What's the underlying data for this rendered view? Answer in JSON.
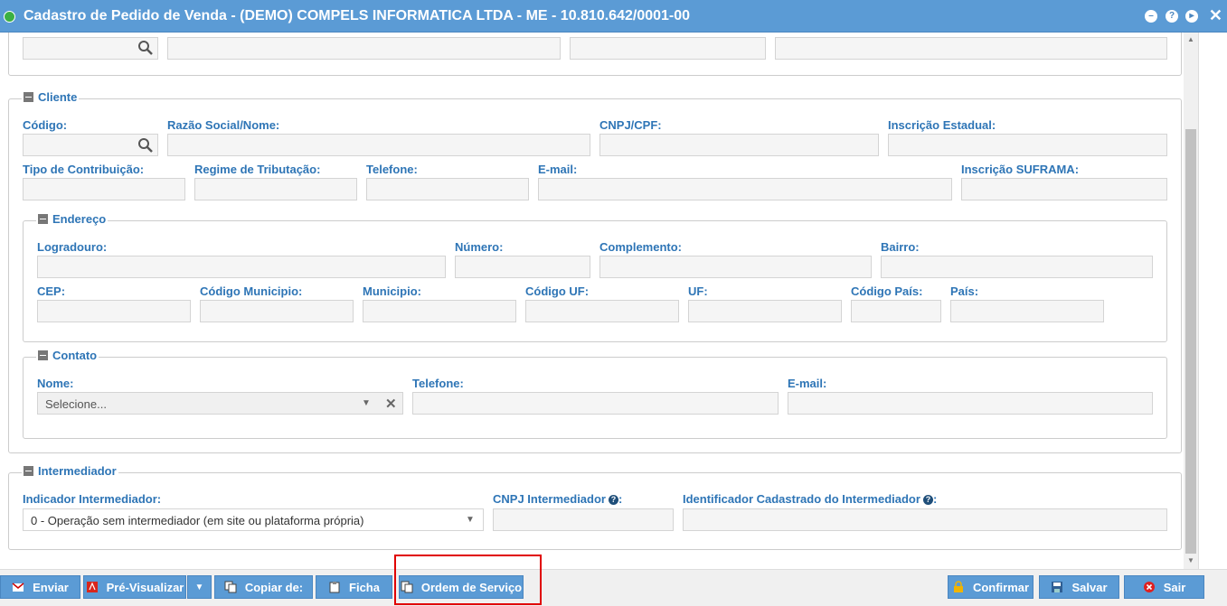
{
  "window": {
    "title": "Cadastro de Pedido de Venda - (DEMO) COMPELS INFORMATICA LTDA - ME - 10.810.642/0001-00",
    "controls": [
      "minimize-icon",
      "help-icon",
      "play-icon",
      "close-icon"
    ],
    "help_glyph": "?",
    "close_glyph": "✕"
  },
  "cliente": {
    "legend": "Cliente",
    "labels": {
      "codigo": "Código:",
      "razao": "Razão Social/Nome:",
      "cnpj": "CNPJ/CPF:",
      "ie": "Inscrição Estadual:",
      "tipo": "Tipo de Contribuição:",
      "regime": "Regime de Tributação:",
      "telefone": "Telefone:",
      "email": "E-mail:",
      "suframa": "Inscrição SUFRAMA:"
    }
  },
  "endereco": {
    "legend": "Endereço",
    "labels": {
      "logradouro": "Logradouro:",
      "numero": "Número:",
      "complemento": "Complemento:",
      "bairro": "Bairro:",
      "cep": "CEP:",
      "cod_municipio": "Código Municipio:",
      "municipio": "Municipio:",
      "cod_uf": "Código UF:",
      "uf": "UF:",
      "cod_pais": "Código País:",
      "pais": "País:"
    }
  },
  "contato": {
    "legend": "Contato",
    "labels": {
      "nome": "Nome:",
      "telefone": "Telefone:",
      "email": "E-mail:"
    },
    "nome_placeholder": "Selecione..."
  },
  "intermediador": {
    "legend": "Intermediador",
    "labels": {
      "indicador": "Indicador Intermediador:",
      "cnpj": "CNPJ Intermediador",
      "identificador": "Identificador Cadastrado do Intermediador"
    },
    "indicador_value": "0 - Operação sem intermediador (em site ou plataforma própria)",
    "help_glyph": "?"
  },
  "toolbar": {
    "enviar": "Enviar",
    "previsualizar": "Pré-Visualizar",
    "copiar": "Copiar de:",
    "ficha": "Ficha",
    "ordem": "Ordem de Serviço",
    "confirmar": "Confirmar",
    "salvar": "Salvar",
    "sair": "Sair"
  },
  "colors": {
    "titlebar": "#5b9bd5",
    "label": "#2e75b6",
    "button": "#5b9bd5",
    "highlight": "#e00000"
  }
}
